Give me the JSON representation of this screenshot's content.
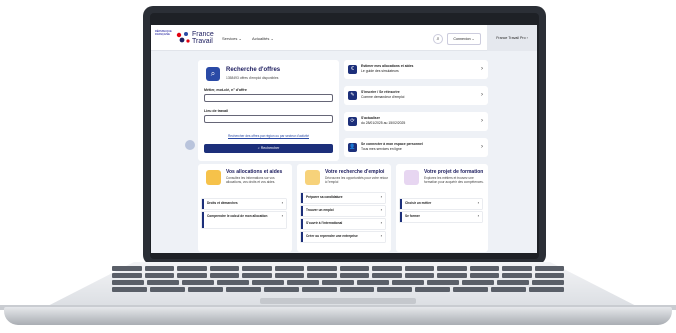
{
  "header": {
    "rf_text": "RÉPUBLIQUE FRANÇAISE",
    "logo": "France Travail",
    "nav": [
      "Services ⌄",
      "Actualités ⌄"
    ],
    "search_icon": "search-icon",
    "connexion": "Connexion ⌄",
    "pro": "France Travail Pro ›"
  },
  "search": {
    "title": "Recherche d'offres",
    "subtitle": "1358493 offres d'emploi disponibles",
    "job_label": "Métier, mot-clé, n° d'offre",
    "job_value": "",
    "place_label": "Lieu de travail",
    "place_value": "",
    "link": "Rechercher des offres par région ou par secteur d'activité",
    "button": "⌕ Rechercher"
  },
  "quick_links": [
    {
      "icon": "€",
      "title": "Estimer mes allocations et aides",
      "subtitle": "Le guide des simulateurs"
    },
    {
      "icon": "✎",
      "title": "S'inscrire / Se réinscrire",
      "subtitle": "Comme demandeur d'emploi"
    },
    {
      "icon": "⟳",
      "title": "S'actualiser",
      "subtitle": "du 28/01/2025 au 15/02/2025"
    },
    {
      "icon": "👤",
      "title": "Se connecter à mon espace personnel",
      "subtitle": "Tous mes services en ligne"
    }
  ],
  "cards": [
    {
      "title": "Vos allocations et aides",
      "desc": "Consultez les informations sur vos allocations, vos droits et vos aides.",
      "icon_color": "#f6c24a",
      "links": [
        "Droits et démarches",
        "Comprendre le calcul de mon allocation"
      ]
    },
    {
      "title": "Votre recherche d'emploi",
      "desc": "Décrouvez les opportunités pour votre retour à l'emploi",
      "icon_color": "#f7d27a",
      "links": [
        "Préparer sa candidature",
        "Trouver un emploi",
        "S'ouvrir à l'international",
        "Créer ou reprendre une entreprise"
      ]
    },
    {
      "title": "Votre projet de formation",
      "desc": "Explorez les métiers et trouvez une formation pour acquérir des compétences.",
      "icon_color": "#e7d6f1",
      "links": [
        "Choisir un métier",
        "Se former"
      ]
    }
  ],
  "colors": {
    "navy": "#1c2f7a",
    "brand": "#1c1c5e",
    "bg": "#eef1f6"
  }
}
